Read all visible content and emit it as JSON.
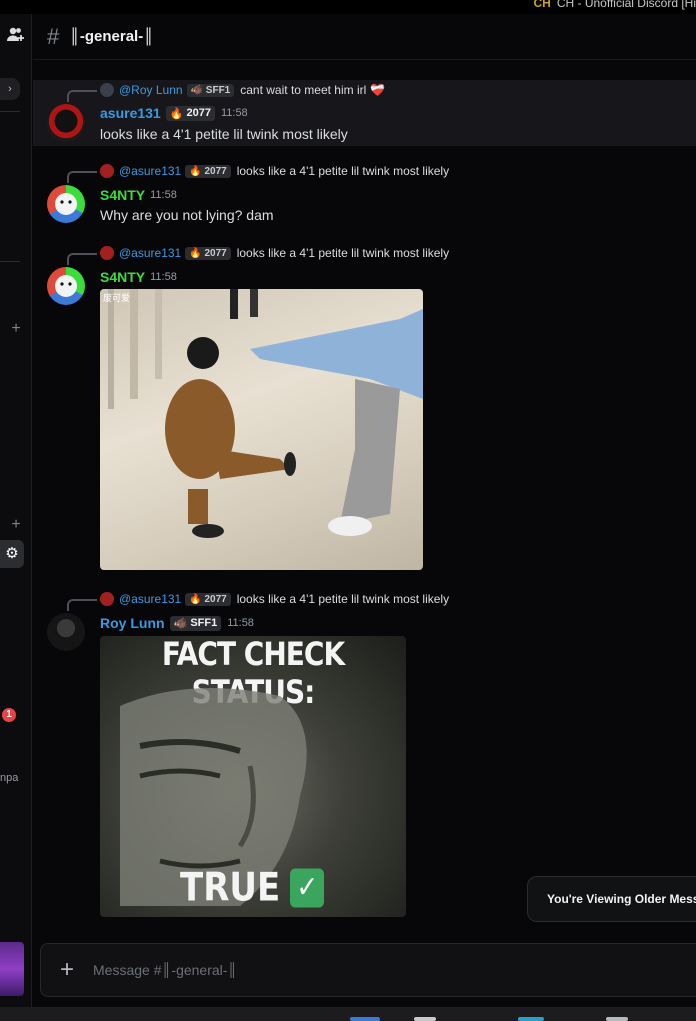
{
  "window": {
    "title": "CH - Unofficial Discord [Hi",
    "logo_text": "CH"
  },
  "channel": {
    "hash": "#",
    "name": "║-general-║"
  },
  "rail": {
    "unread_badge": "1",
    "cut_label": "npa"
  },
  "messages": [
    {
      "reply_to": {
        "author": "@Roy Lunn",
        "tag": "SFF1",
        "text": "cant wait to meet him irl",
        "emoji": "❤️‍🩹"
      },
      "author": "asure131",
      "author_color": "#3b9ae0",
      "tag": "2077",
      "time": "11:58",
      "text": "looks like a 4'1 petite lil twink most likely"
    },
    {
      "reply_to": {
        "author": "@asure131",
        "tag": "2077",
        "text": "looks like a 4'1 petite lil twink most likely"
      },
      "author": "S4NTY",
      "author_color": "#3ddc3d",
      "time": "11:58",
      "text": "Why are you not lying? dam"
    },
    {
      "reply_to": {
        "author": "@asure131",
        "tag": "2077",
        "text": "looks like a 4'1 petite lil twink most likely"
      },
      "author": "S4NTY",
      "author_color": "#3ddc3d",
      "time": "11:58",
      "media_caption": "废可爱"
    },
    {
      "reply_to": {
        "author": "@asure131",
        "tag": "2077",
        "text": "looks like a 4'1 petite lil twink most likely"
      },
      "author": "Roy Lunn",
      "author_color": "#3b9ae0",
      "tag": "SFF1",
      "time": "11:58",
      "media_title": "FACT CHECK STATUS:",
      "media_verdict": "TRUE"
    }
  ],
  "older_notice": "You're Viewing Older Messa",
  "composer": {
    "placeholder": "Message #║-general-║",
    "plus": "+"
  },
  "colors": {
    "accent": "#3b9ae0",
    "green_name": "#3ddc3d",
    "background": "#070709"
  },
  "icons": [
    "add-friend-icon",
    "chevron-right-icon",
    "plus-icon",
    "gear-icon",
    "hash-icon"
  ]
}
